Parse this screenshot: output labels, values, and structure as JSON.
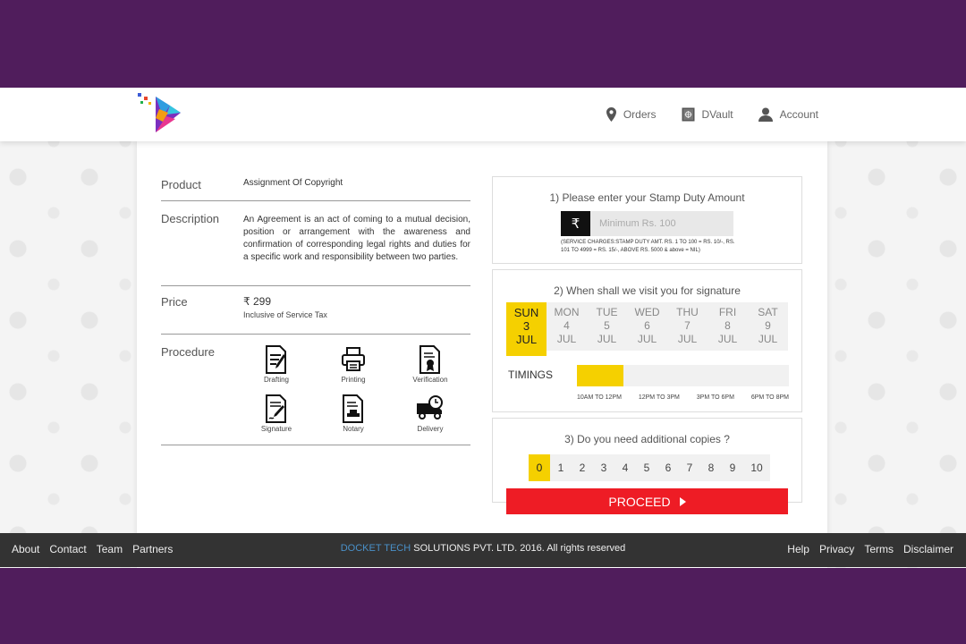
{
  "nav": {
    "orders": "Orders",
    "dvault": "DVault",
    "account": "Account"
  },
  "product": {
    "label": "Product",
    "value": "Assignment Of Copyright"
  },
  "description": {
    "label": "Description",
    "value": "An Agreement is an act of coming to a mutual decision, position or arrangement with the awareness and confirmation of corresponding legal rights and duties for a specific work and responsibility between two parties."
  },
  "price": {
    "label": "Price",
    "amount": "₹ 299",
    "note": "Inclusive of Service Tax"
  },
  "procedure": {
    "label": "Procedure",
    "steps": [
      "Drafting",
      "Printing",
      "Verification",
      "Signature",
      "Notary",
      "Delivery"
    ]
  },
  "stamp": {
    "title": "1) Please enter your Stamp Duty Amount",
    "currency_symbol": "₹",
    "placeholder": "Minimum Rs. 100",
    "note": "(SERVICE CHARGES:STAMP DUTY AMT. RS. 1 TO 100 = RS. 10/-, RS. 101 TO 4999 = RS. 15/-, ABOVE RS. 5000 & above = NIL)"
  },
  "schedule": {
    "title": "2) When shall we visit you for signature",
    "days": [
      {
        "dow": "SUN",
        "date": "3",
        "month": "JUL",
        "selected": true
      },
      {
        "dow": "MON",
        "date": "4",
        "month": "JUL",
        "selected": false
      },
      {
        "dow": "TUE",
        "date": "5",
        "month": "JUL",
        "selected": false
      },
      {
        "dow": "WED",
        "date": "6",
        "month": "JUL",
        "selected": false
      },
      {
        "dow": "THU",
        "date": "7",
        "month": "JUL",
        "selected": false
      },
      {
        "dow": "FRI",
        "date": "8",
        "month": "JUL",
        "selected": false
      },
      {
        "dow": "SAT",
        "date": "9",
        "month": "JUL",
        "selected": false
      }
    ],
    "timings_label": "TIMINGS",
    "slots": [
      "10AM TO 12PM",
      "12PM TO 3PM",
      "3PM TO 6PM",
      "6PM TO 8PM"
    ],
    "selected_fraction": 0.22
  },
  "copies": {
    "title": "3) Do you need additional copies ?",
    "options": [
      "0",
      "1",
      "2",
      "3",
      "4",
      "5",
      "6",
      "7",
      "8",
      "9",
      "10"
    ],
    "selected": "0"
  },
  "proceed_label": "PROCEED",
  "footer": {
    "left_links": [
      "About",
      "Contact",
      "Team",
      "Partners"
    ],
    "brand": "DOCKET TECH",
    "copyright": " SOLUTIONS PVT. LTD. 2016. All rights reserved",
    "right_links": [
      "Help",
      "Privacy",
      "Terms",
      "Disclaimer"
    ]
  },
  "colors": {
    "page_bg": "#501d5c",
    "accent_yellow": "#f5d000",
    "proceed_red": "#ee1c25",
    "footer_bg": "#333333",
    "brand_blue": "#4a90c8"
  }
}
